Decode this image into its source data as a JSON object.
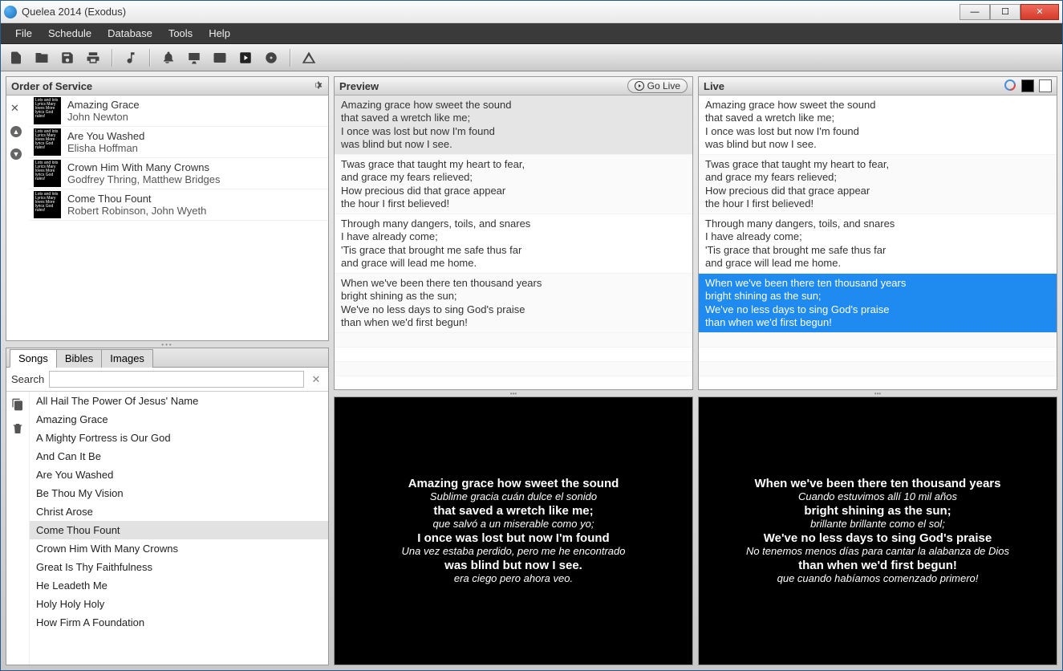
{
  "window": {
    "title": "Quelea 2014 (Exodus)"
  },
  "menu": {
    "items": [
      "File",
      "Schedule",
      "Database",
      "Tools",
      "Help"
    ]
  },
  "panels": {
    "order": {
      "title": "Order of Service"
    },
    "preview": {
      "title": "Preview",
      "go_live": "Go Live"
    },
    "live": {
      "title": "Live"
    },
    "search_label": "Search",
    "tabs": [
      "Songs",
      "Bibles",
      "Images"
    ],
    "active_tab": 0
  },
  "order_of_service": [
    {
      "title": "Amazing Grace",
      "author": "John Newton"
    },
    {
      "title": "Are You Washed",
      "author": "Elisha Hoffman"
    },
    {
      "title": "Crown Him With Many Crowns",
      "author": "Godfrey Thring, Matthew Bridges"
    },
    {
      "title": "Come Thou Fount",
      "author": "Robert Robinson, John Wyeth"
    }
  ],
  "library_songs": [
    "All Hail The Power Of Jesus' Name",
    "Amazing Grace",
    "A Mighty Fortress is Our God",
    "And Can It Be",
    "Are You Washed",
    "Be Thou My Vision",
    "Christ Arose",
    "Come Thou Fount",
    "Crown Him With Many Crowns",
    "Great Is Thy Faithfulness",
    "He Leadeth Me",
    "Holy Holy Holy",
    "How Firm A Foundation"
  ],
  "library_selected_index": 7,
  "verses": [
    [
      "Amazing grace how sweet the sound",
      "that saved a wretch like me;",
      "I once was lost but now I'm found",
      "was blind but now I see."
    ],
    [
      "Twas grace that taught my heart to fear,",
      "and grace my fears relieved;",
      "How precious did that grace appear",
      "the hour I first believed!"
    ],
    [
      "Through many dangers, toils, and snares",
      "I have already come;",
      "'Tis grace that brought me safe thus far",
      "and grace will lead me home."
    ],
    [
      "When we've been there ten thousand years",
      "bright shining as the sun;",
      "We've no less days to sing God's praise",
      "than when we'd first begun!"
    ]
  ],
  "preview_selected": 0,
  "live_selected": 3,
  "preview_projector": {
    "pairs": [
      {
        "en": "Amazing grace how sweet the sound",
        "es": "Sublime gracia cuán dulce el sonido"
      },
      {
        "en": "that saved a wretch like me;",
        "es": "que salvó a un miserable como yo;"
      },
      {
        "en": "I once was lost but now I'm found",
        "es": "Una vez estaba perdido, pero me he encontrado"
      },
      {
        "en": "was blind but now I see.",
        "es": "era ciego pero ahora veo."
      }
    ]
  },
  "live_projector": {
    "pairs": [
      {
        "en": "When we've been there ten thousand years",
        "es": "Cuando estuvimos allí 10 mil años"
      },
      {
        "en": "bright shining as the sun;",
        "es": "brillante brillante como el sol;"
      },
      {
        "en": "We've no less days to sing God's praise",
        "es": "No tenemos menos días para cantar la alabanza de Dios"
      },
      {
        "en": "than when we'd first begun!",
        "es": "que cuando habíamos comenzado primero!"
      }
    ]
  }
}
